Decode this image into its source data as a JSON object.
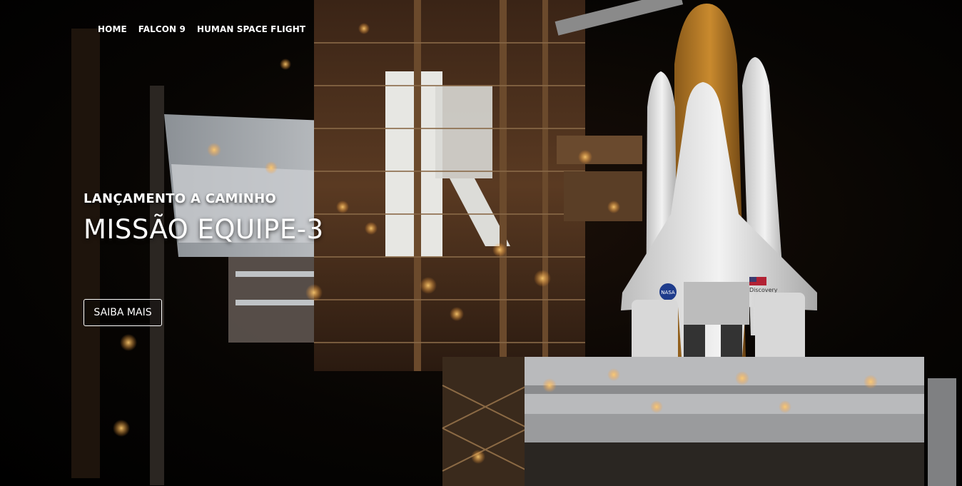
{
  "nav": {
    "items": [
      {
        "label": "HOME"
      },
      {
        "label": "FALCON 9"
      },
      {
        "label": "HUMAN SPACE FLIGHT"
      }
    ]
  },
  "hero": {
    "kicker": "LANÇAMENTO A CAMINHO",
    "headline": "MISSÃO EQUIPE-3",
    "cta_label": "SAIBA MAIS",
    "image_subject": "space-shuttle-launch-pad-night",
    "shuttle_markings": {
      "agency": "NASA",
      "orbiter_name": "Discovery"
    }
  }
}
